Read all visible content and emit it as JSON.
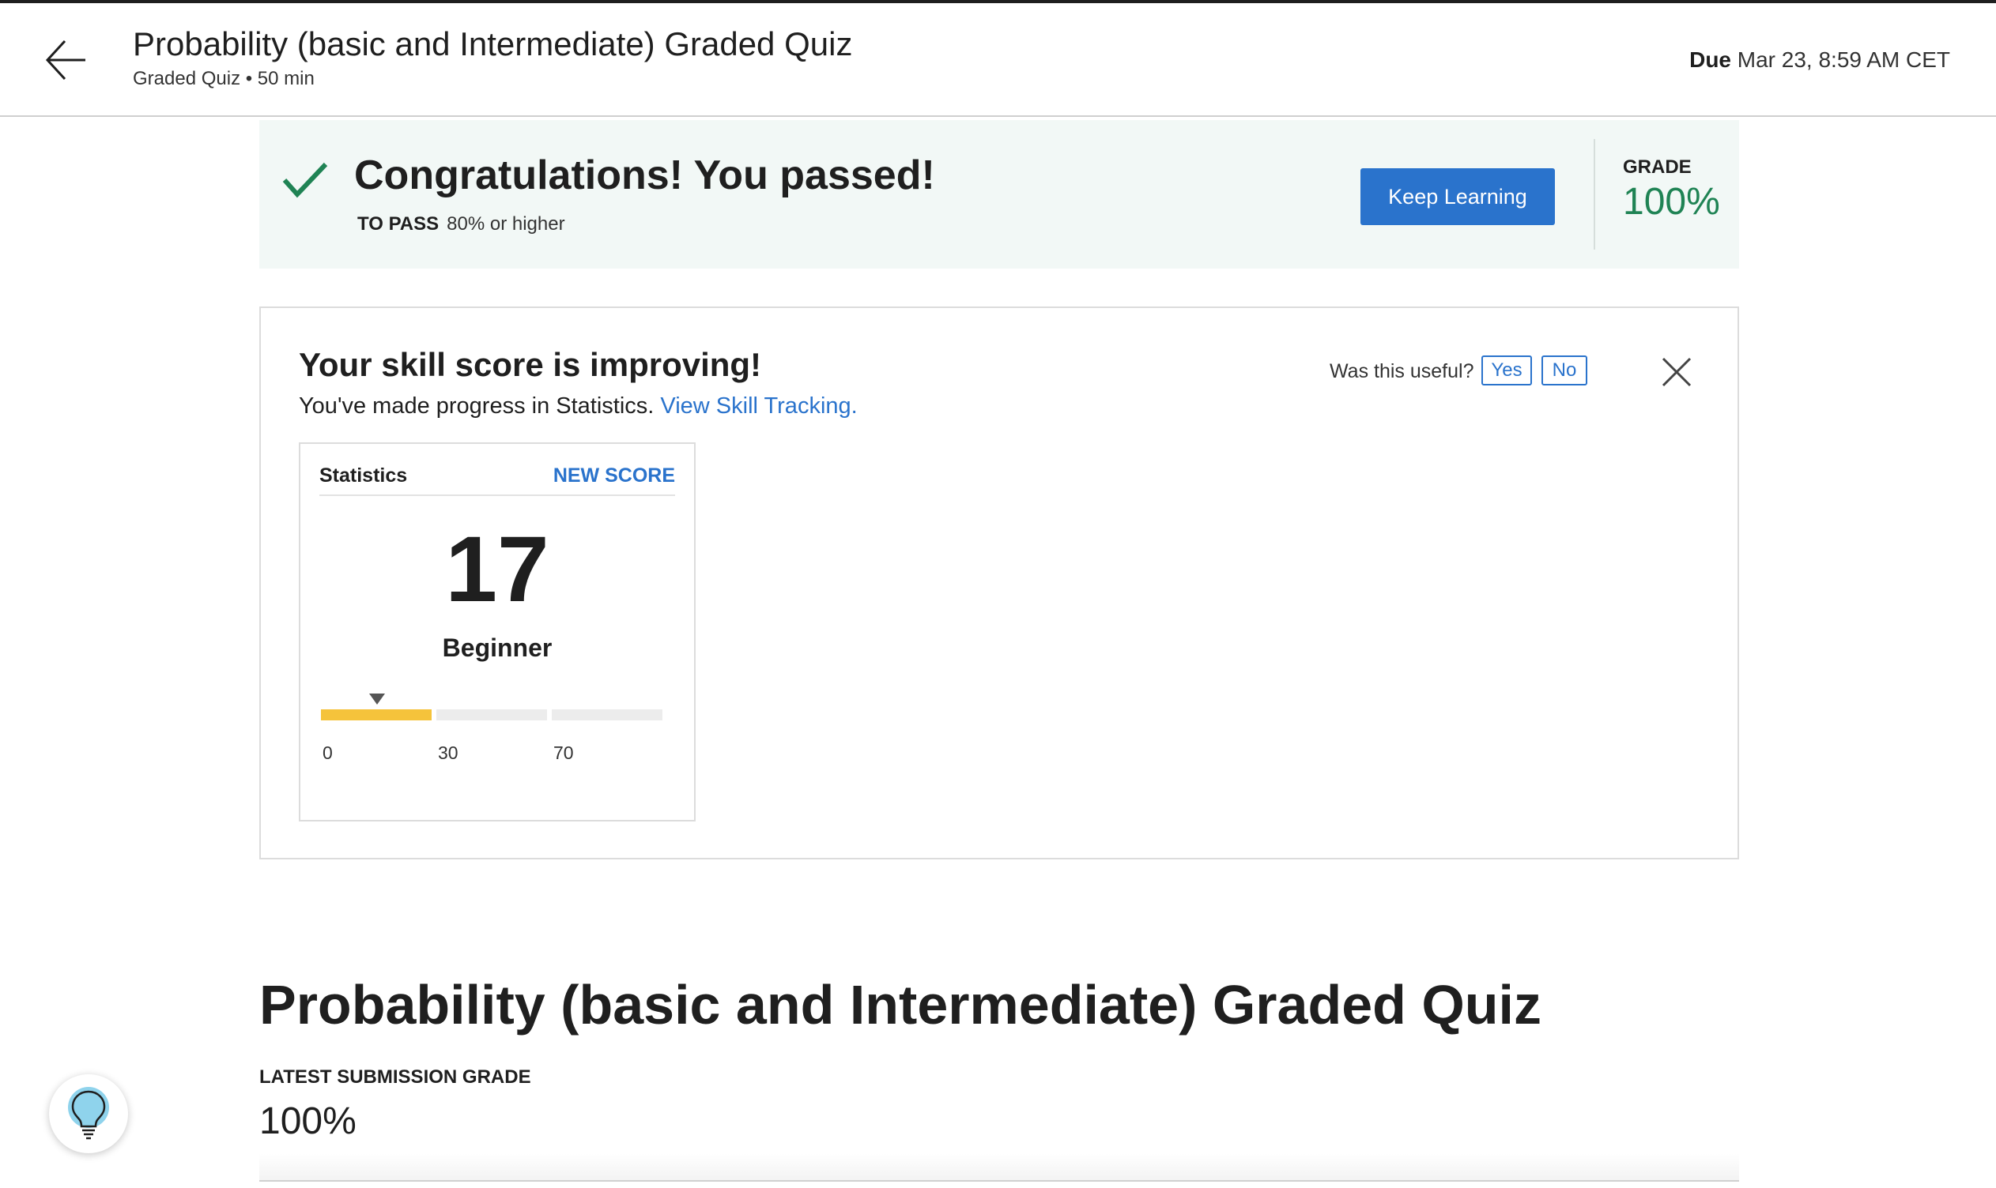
{
  "header": {
    "back_label": "back-arrow",
    "title": "Probability (basic and Intermediate) Graded Quiz",
    "subtitle": "Graded Quiz • 50 min",
    "due_label": "Due",
    "due_value": "Mar 23, 8:59 AM CET"
  },
  "banner": {
    "title": "Congratulations! You passed!",
    "to_pass_label": "TO PASS",
    "to_pass_value": "80% or higher",
    "button_label": "Keep Learning",
    "grade_label": "GRADE",
    "grade_value": "100%",
    "accent_color": "#1f8354",
    "button_color": "#2a73cc"
  },
  "skill": {
    "title": "Your skill score is improving!",
    "description": "You've made progress in Statistics.",
    "link_text": "View Skill Tracking.",
    "feedback_label": "Was this useful?",
    "yes_label": "Yes",
    "no_label": "No",
    "close_icon": "close-icon",
    "score_card": {
      "skill_name": "Statistics",
      "badge": "NEW SCORE",
      "score": "17",
      "level": "Beginner",
      "ticks": [
        "0",
        "30",
        "70"
      ],
      "score_value": 17,
      "bar_color": "#f5c33b"
    }
  },
  "main": {
    "title": "Probability (basic and Intermediate) Graded Quiz",
    "latest_label": "LATEST SUBMISSION GRADE",
    "latest_value": "100%"
  },
  "help": {
    "icon": "lightbulb-icon"
  }
}
